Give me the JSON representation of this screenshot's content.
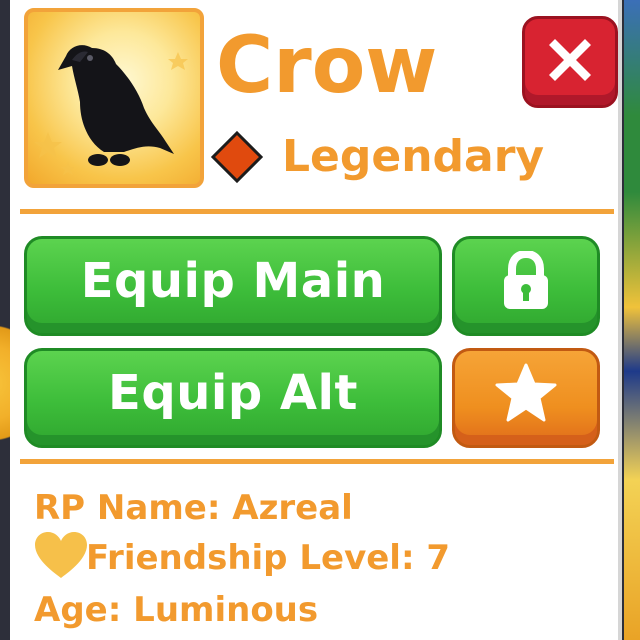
{
  "pet": {
    "name": "Crow",
    "rarity": "Legendary",
    "rarity_color": "#e04a0e",
    "accent_color": "#f29a2e"
  },
  "actions": {
    "close_icon": "close-icon",
    "equip_main_label": "Equip Main",
    "lock_icon": "lock-icon",
    "equip_alt_label": "Equip Alt",
    "favorite_icon": "star-icon"
  },
  "info": {
    "rp_name_label": "RP Name:",
    "rp_name_value": "Azreal",
    "friendship_label": "Friendship Level:",
    "friendship_value": "7",
    "age_label": "Age:",
    "age_value": "Luminous"
  }
}
